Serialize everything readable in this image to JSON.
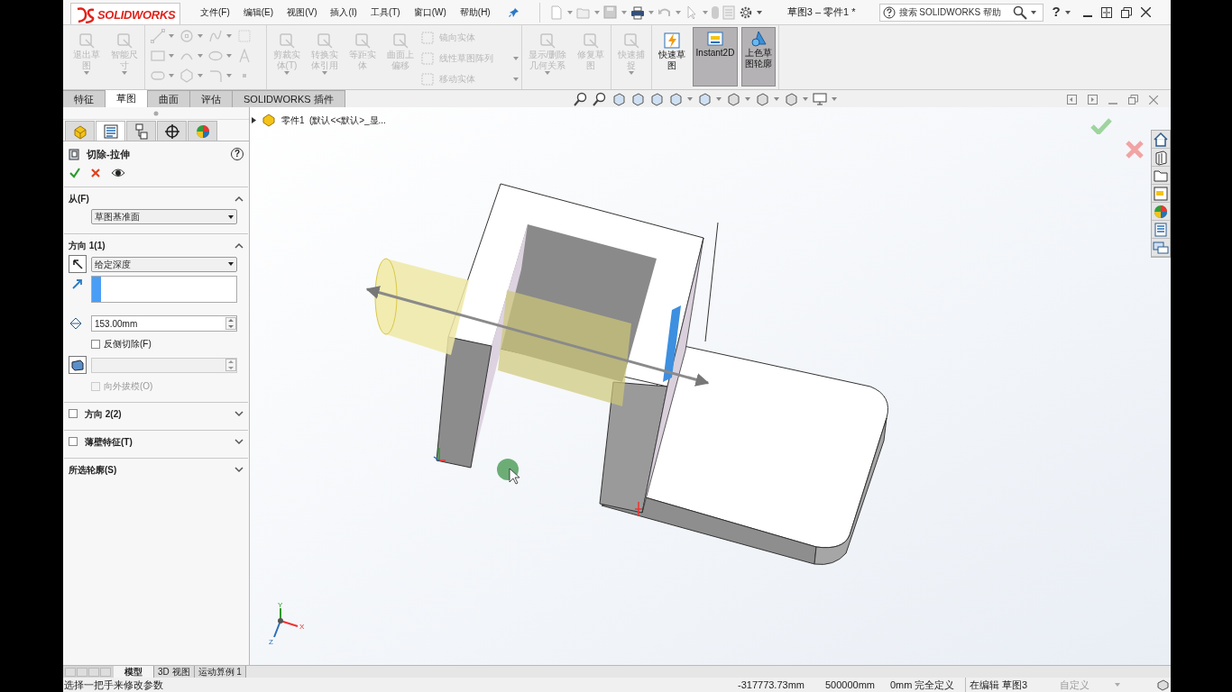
{
  "logo": "SOLIDWORKS",
  "menu": [
    "文件(F)",
    "编辑(E)",
    "视图(V)",
    "插入(I)",
    "工具(T)",
    "窗口(W)",
    "帮助(H)"
  ],
  "document_title": "草图3 – 零件1 *",
  "search": {
    "placeholder": "搜索 SOLIDWORKS 帮助"
  },
  "help_button": "?",
  "ribbon": [
    {
      "items": [
        {
          "kind": "large",
          "label": "退出草图",
          "disabled": true,
          "selected": false,
          "has_menu": true
        },
        {
          "kind": "large",
          "label": "智能尺寸",
          "disabled": true,
          "selected": false,
          "has_menu": true
        }
      ]
    },
    {
      "items": [
        {
          "kind": "large",
          "label": "剪裁实体(T)",
          "disabled": true,
          "selected": false,
          "has_menu": true
        },
        {
          "kind": "large",
          "label": "转换实体引用",
          "disabled": true,
          "selected": false,
          "has_menu": true
        },
        {
          "kind": "large",
          "label": "等距实体",
          "disabled": true,
          "selected": false,
          "has_menu": false
        },
        {
          "kind": "large",
          "label": "曲面上偏移",
          "disabled": true,
          "selected": false,
          "has_menu": false
        },
        {
          "kind": "small",
          "label": "镜向实体",
          "disabled": true,
          "selected": false,
          "has_menu": false
        },
        {
          "kind": "small",
          "label": "线性草图阵列",
          "disabled": true,
          "selected": false,
          "has_menu": true
        },
        {
          "kind": "small",
          "label": "移动实体",
          "disabled": true,
          "selected": false,
          "has_menu": true
        }
      ]
    },
    {
      "items": [
        {
          "kind": "large",
          "label": "显示/删除几何关系",
          "disabled": true,
          "selected": false,
          "has_menu": true
        },
        {
          "kind": "large",
          "label": "修复草图",
          "disabled": true,
          "selected": false,
          "has_menu": false
        }
      ]
    },
    {
      "items": [
        {
          "kind": "large",
          "label": "快速捕捉",
          "disabled": true,
          "selected": false,
          "has_menu": true
        }
      ]
    },
    {
      "items": [
        {
          "kind": "large",
          "label": "快速草图",
          "disabled": false,
          "selected": false,
          "has_menu": false
        },
        {
          "kind": "large",
          "label": "Instant2D",
          "disabled": false,
          "selected": true,
          "has_menu": false
        },
        {
          "kind": "large",
          "label": "上色草图轮廓",
          "disabled": false,
          "selected": true,
          "has_menu": false
        }
      ]
    }
  ],
  "command_tabs": [
    {
      "label": "特征",
      "selected": false
    },
    {
      "label": "草图",
      "selected": true
    },
    {
      "label": "曲面",
      "selected": false
    },
    {
      "label": "评估",
      "selected": false
    },
    {
      "label": "SOLIDWORKS 插件",
      "selected": false
    }
  ],
  "panel_tabs": [
    {
      "selected": false
    },
    {
      "selected": true
    },
    {
      "selected": false
    },
    {
      "selected": false
    },
    {
      "selected": false
    }
  ],
  "property_manager": {
    "title": "切除-拉伸",
    "help": "?",
    "sections": [
      {
        "kind": "from",
        "label": "从(F)",
        "expanded": true,
        "dropdown": "草图基准面"
      },
      {
        "kind": "direction",
        "label": "方向 1(1)",
        "expanded": true,
        "dropdown": "给定深度",
        "depth": "153.00mm",
        "reverse_cut": {
          "label": "反侧切除(F)",
          "checked": false
        },
        "draft_outward": {
          "label": "向外拔模(O)",
          "checked": false,
          "disabled": true
        }
      },
      {
        "kind": "option",
        "label": "方向 2(2)",
        "checked": false,
        "expanded": false
      },
      {
        "kind": "option",
        "label": "薄壁特征(T)",
        "checked": false,
        "expanded": false
      },
      {
        "kind": "plain",
        "label": "所选轮廓(S)",
        "expanded": false
      }
    ]
  },
  "feature_tree": {
    "label": "零件1  (默认<<默认>_显..."
  },
  "triad": {
    "x": "X",
    "y": "Y",
    "z": "Z"
  },
  "bottom_tabs": [
    {
      "label": "模型",
      "selected": true
    },
    {
      "label": "3D 视图",
      "selected": false
    },
    {
      "label": "运动算例 1",
      "selected": false
    }
  ],
  "status_bar": {
    "message": "选择一把手来修改参数",
    "fields": [
      "-317773.73mm",
      "500000mm",
      "0mm",
      "完全定义",
      "在编辑 草图3"
    ],
    "customize": "自定义"
  }
}
